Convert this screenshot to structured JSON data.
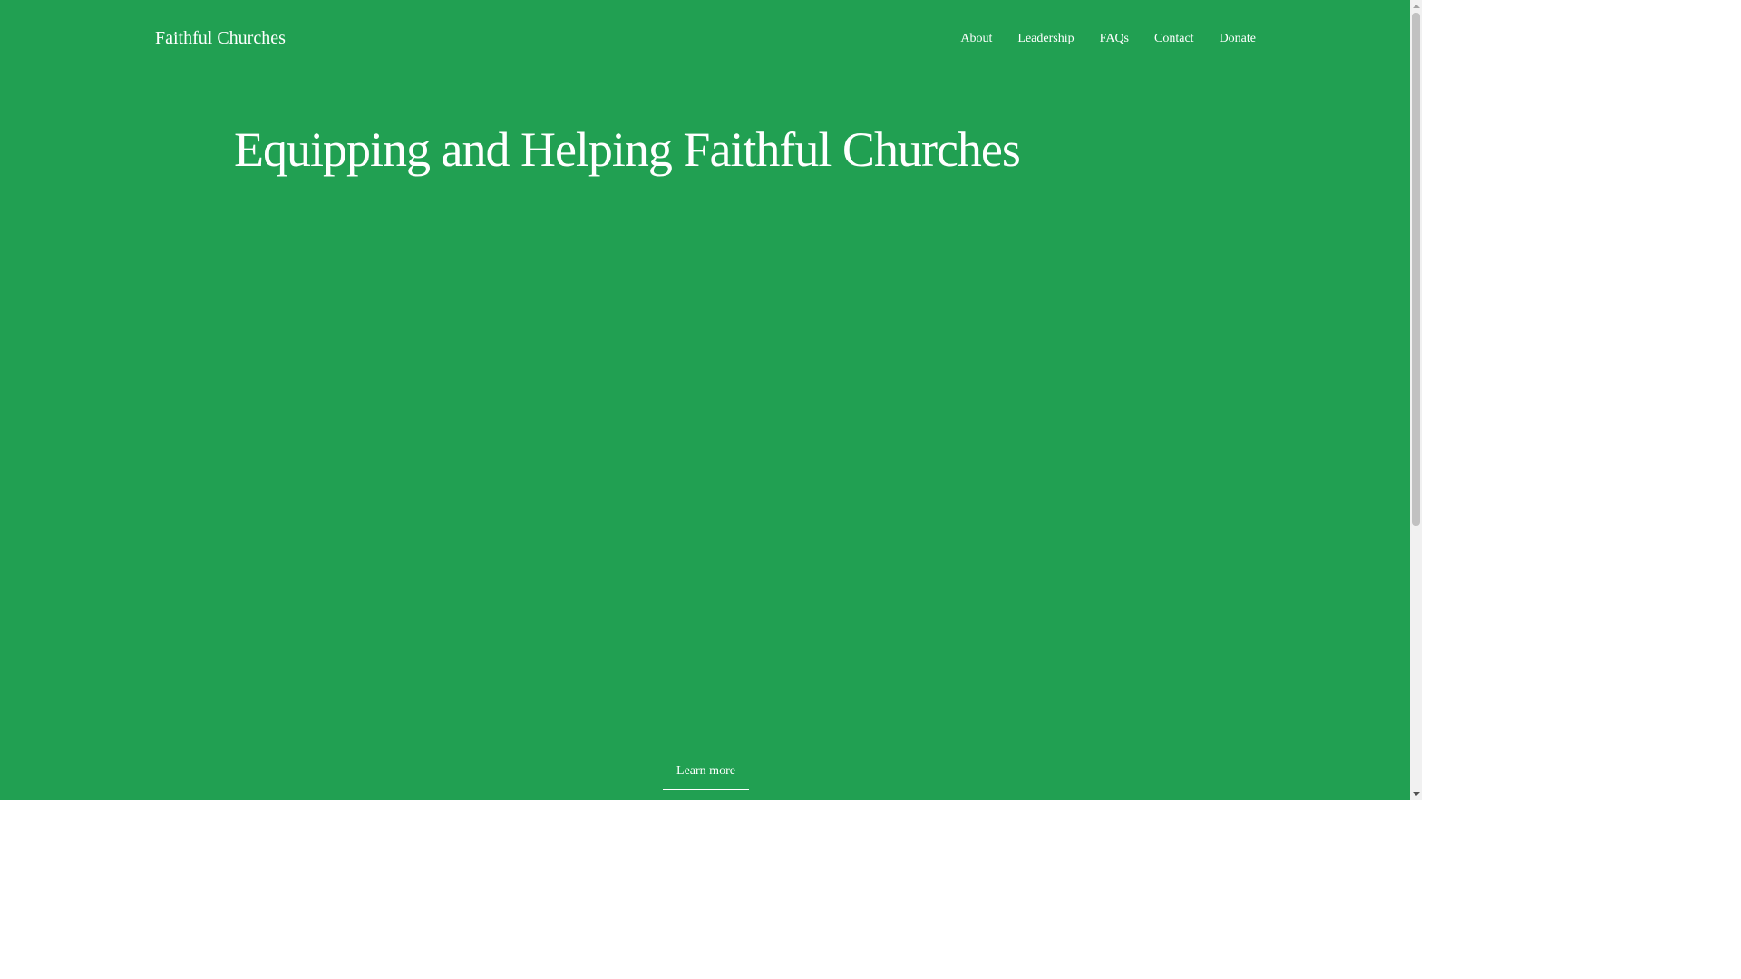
{
  "header": {
    "site_title": "Faithful Churches",
    "nav": [
      {
        "label": "About"
      },
      {
        "label": "Leadership"
      },
      {
        "label": "FAQs"
      },
      {
        "label": "Contact"
      },
      {
        "label": "Donate"
      }
    ]
  },
  "hero": {
    "heading": "Equipping and Helping Faithful Churches",
    "learn_more_label": "Learn more"
  },
  "colors": {
    "background": "#21a052",
    "text": "#ffffff"
  },
  "scrollbar": {
    "up_icon": "scroll-up-arrow-icon",
    "down_icon": "scroll-down-arrow-icon"
  }
}
